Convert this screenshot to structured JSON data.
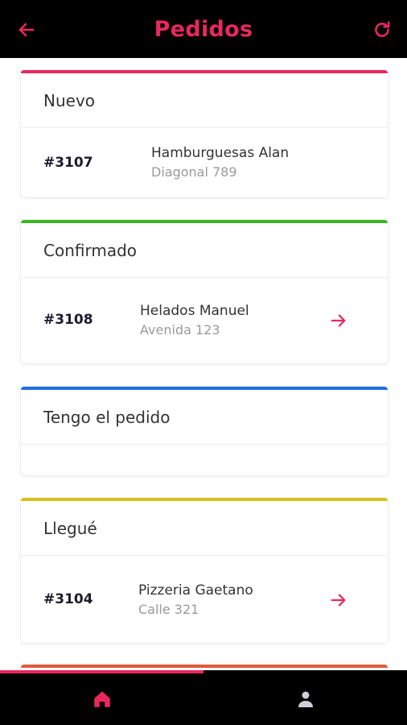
{
  "header": {
    "title": "Pedidos",
    "back_icon": "arrow-left-icon",
    "refresh_icon": "refresh-icon"
  },
  "colors": {
    "accent": "#e8285e",
    "nuevo": "#e8285e",
    "confirmado": "#3cb521",
    "tengo": "#1e6fe0",
    "llegue": "#d7c11c",
    "next": "#e05a3a"
  },
  "sections": {
    "nuevo": {
      "title": "Nuevo",
      "order": {
        "number": "#3107",
        "restaurant": "Hamburguesas Alan",
        "address": "Diagonal 789"
      }
    },
    "confirmado": {
      "title": "Confirmado",
      "order": {
        "number": "#3108",
        "restaurant": "Helados Manuel",
        "address": "Avenida 123"
      }
    },
    "tengo": {
      "title": "Tengo el pedido"
    },
    "llegue": {
      "title": "Llegué",
      "order": {
        "number": "#3104",
        "restaurant": "Pizzeria Gaetano",
        "address": "Calle 321"
      }
    }
  },
  "bottom_nav": {
    "home_icon": "home-icon",
    "profile_icon": "user-icon",
    "active_tab": "home"
  }
}
